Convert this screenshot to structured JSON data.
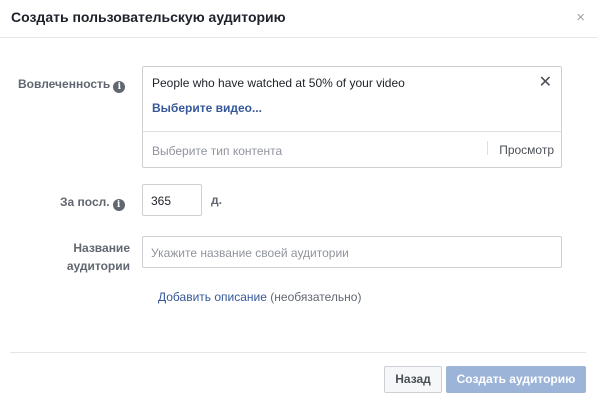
{
  "dialog": {
    "title": "Создать пользовательскую аудиторию",
    "close_glyph": "×"
  },
  "engagement": {
    "label": "Вовлеченность",
    "info_glyph": "i",
    "selected_item": "People who have watched at 50% of your video",
    "remove_glyph": "✕",
    "choose_video": "Выберите видео...",
    "content_type_placeholder": "Выберите тип контента",
    "preview_label": "Просмотр"
  },
  "period": {
    "label": "За посл.",
    "info_glyph": "i",
    "value": "365",
    "unit": "д."
  },
  "audience_name": {
    "label_line1": "Название",
    "label_line2": "аудитории",
    "placeholder": "Укажите название своей аудитории",
    "value": ""
  },
  "description": {
    "link_label": "Добавить описание",
    "optional_label": "(необязательно)"
  },
  "footer": {
    "back_label": "Назад",
    "create_label": "Создать аудиторию"
  },
  "colors": {
    "link": "#365899",
    "primary_disabled": "#9cb4d8",
    "label": "#606770"
  },
  "icons": {
    "close": "close-icon",
    "info": "info-icon",
    "remove": "remove-icon"
  }
}
